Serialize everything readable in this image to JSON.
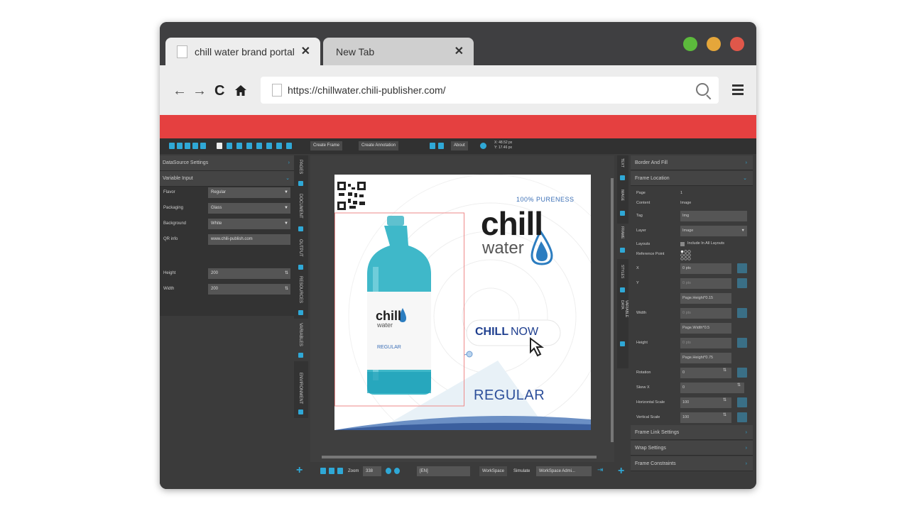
{
  "browser": {
    "tabs": [
      {
        "title": "chill water brand portal",
        "close": "✕"
      },
      {
        "title": "New Tab",
        "close": "✕"
      }
    ],
    "url": "https://chillwater.chili-publisher.com/",
    "colors": {
      "close": "#e0574a",
      "minimize": "#e5a63a",
      "maximize": "#5cba3c",
      "accent_bar": "#e54040"
    }
  },
  "app": {
    "toolbar": {
      "create_frame": "Create Frame",
      "create_annotation": "Create Annotation",
      "about": "About",
      "coords": {
        "x": "X: 48.52 px",
        "y": "Y: 17.46 px"
      }
    },
    "left_panel": {
      "sections": [
        {
          "label": "DataSource Settings",
          "chev": "›"
        },
        {
          "label": "Variable Input",
          "chev": "⌄"
        }
      ],
      "variables": [
        {
          "label": "Flavor",
          "value": "Regular",
          "dropdown": true
        },
        {
          "label": "Packaging",
          "value": "Glass",
          "dropdown": true
        },
        {
          "label": "Background",
          "value": "White",
          "dropdown": true
        },
        {
          "label": "QR info",
          "value": "www.chili-publish.com",
          "dropdown": false
        },
        {
          "label": "Height",
          "value": "200",
          "dropdown": false
        },
        {
          "label": "Width",
          "value": "200",
          "dropdown": false
        }
      ]
    },
    "vertical_tabs": [
      "PAGES",
      "DOCUMENT",
      "OUTPUT",
      "RESOURCES",
      "VARIABLES",
      "ENVIRONMENT"
    ],
    "right_tabs": [
      "TEXT",
      "IMAGE",
      "FRAME",
      "STYLES",
      "VARIABLE DATA"
    ],
    "document": {
      "pureness": "100% PURENESS",
      "brand_chill": "chill",
      "brand_water": "water",
      "label_chill": "chill",
      "label_water": "water",
      "label_flavor": "REGULAR",
      "cta_bold": "CHILL",
      "cta_light": "NOW",
      "flavor": "REGULAR"
    },
    "bottom_bar": {
      "zoom_label": "Zoom",
      "zoom_value": "338",
      "language": "[EN]",
      "workspace": "WorkSpace",
      "simulate_label": "Simulate",
      "simulate_value": "WorkSpace Admi..."
    },
    "right_panel": {
      "sections": {
        "border_fill": "Border And Fill",
        "frame_location": "Frame Location",
        "frame_link": "Frame Link Settings",
        "wrap": "Wrap Settings",
        "constraints": "Frame Constraints"
      },
      "props": {
        "page": {
          "label": "Page",
          "value": "1"
        },
        "content": {
          "label": "Content",
          "value": "Image"
        },
        "tag": {
          "label": "Tag",
          "value": "Img"
        },
        "layer": {
          "label": "Layer",
          "value": "Image"
        },
        "layouts": {
          "label": "Layouts",
          "value": "Include In All Layouts"
        },
        "reference_point": {
          "label": "Reference Point"
        },
        "x": {
          "label": "X",
          "value": "0 pts"
        },
        "y": {
          "label": "Y",
          "value": "0 pts"
        },
        "y_expr": "Page.Height*0.15",
        "width": {
          "label": "Width",
          "value": "0 pts",
          "expr": "Page.Width*0.5"
        },
        "height": {
          "label": "Height",
          "value": "0 pts",
          "expr": "Page.Height*0.75"
        },
        "rotation": {
          "label": "Rotation",
          "value": "0"
        },
        "skew_x": {
          "label": "Skew X",
          "value": "0"
        },
        "h_scale": {
          "label": "Horizontal Scale",
          "value": "100"
        },
        "v_scale": {
          "label": "Vertical Scale",
          "value": "100"
        }
      }
    }
  }
}
